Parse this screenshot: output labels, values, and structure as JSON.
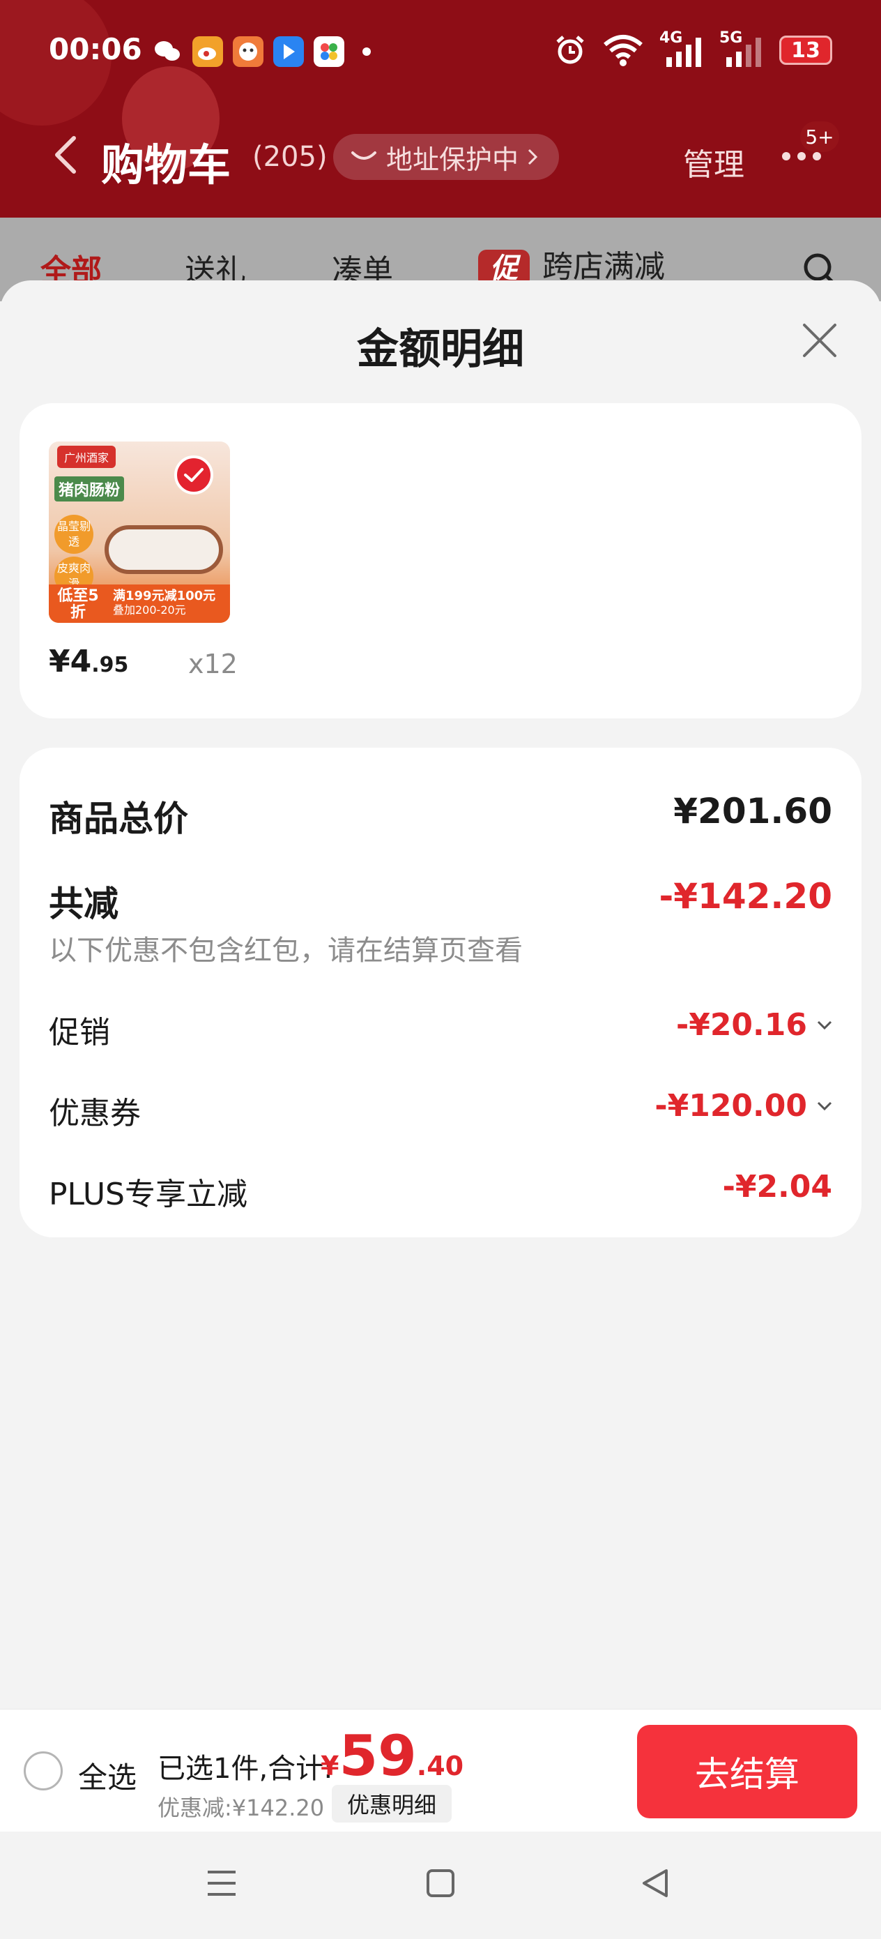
{
  "status_bar": {
    "time": "00:06",
    "network_4g": "4G",
    "network_5g": "5G",
    "battery": "13"
  },
  "header": {
    "title": "购物车",
    "count": "(205)",
    "address_protection": "地址保护中",
    "manage": "管理",
    "more_badge": "5+"
  },
  "tabs": [
    {
      "label": "全部"
    },
    {
      "label": "送礼"
    },
    {
      "label": "凑单"
    },
    {
      "label": "跨店满减",
      "tag": "促"
    }
  ],
  "sheet": {
    "title": "金额明细",
    "product": {
      "brand": "广州酒家",
      "label": "猪肉肠粉",
      "stamp1": "晶莹剔透",
      "stamp2": "皮爽肉滑",
      "discount": "低至5折",
      "promo_line1": "满199元减100元",
      "promo_line2": "叠加200-20元",
      "price_main": "¥4",
      "price_decimal": ".95",
      "quantity": "x12"
    },
    "summary": {
      "total_label": "商品总价",
      "total_value": "¥201.60",
      "reduce_label": "共减",
      "reduce_value": "-¥142.20",
      "note": "以下优惠不包含红包，请在结算页查看",
      "rows": [
        {
          "label": "促销",
          "value": "-¥20.16",
          "expandable": true
        },
        {
          "label": "优惠券",
          "value": "-¥120.00",
          "expandable": true
        },
        {
          "label": "PLUS专享立减",
          "value": "-¥2.04",
          "expandable": false
        }
      ]
    }
  },
  "bottom_bar": {
    "select_all": "全选",
    "selected_text": "已选1件,合计:",
    "total_currency": "¥",
    "total_int": "59",
    "total_dec": ".40",
    "saved_text": "优惠减:¥142.20",
    "detail_button": "优惠明细",
    "checkout_button": "去结算"
  },
  "colors": {
    "header_bg": "#8e0d16",
    "accent_red": "#e0262c",
    "checkout_bg": "#f5323c"
  },
  "icons": [
    "back-icon",
    "shield-smile-icon",
    "more-icon",
    "search-icon",
    "close-icon",
    "check-icon",
    "chevron-down-icon",
    "menu-icon",
    "home-icon",
    "back-triangle-icon",
    "wifi-icon",
    "alarm-icon",
    "signal-icon"
  ]
}
